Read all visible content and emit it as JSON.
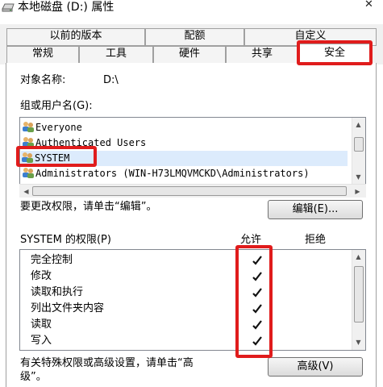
{
  "window": {
    "title": "本地磁盘 (D:) 属性",
    "close_glyph": "✕"
  },
  "tabs": {
    "row_back": [
      "以前的版本",
      "配额",
      "自定义"
    ],
    "row_front": [
      "常规",
      "工具",
      "硬件",
      "共享",
      "安全"
    ],
    "selected": "安全"
  },
  "object": {
    "label": "对象名称:",
    "value": "D:\\"
  },
  "groups": {
    "label": "组或用户名(G):",
    "items": [
      "Everyone",
      "Authenticated Users",
      "SYSTEM",
      "Administrators (WIN-H73LMQVMCKD\\Administrators)"
    ],
    "selected": "SYSTEM"
  },
  "edit": {
    "hint": "要更改权限，请单击“编辑”。",
    "button": "编辑(E)..."
  },
  "permissions": {
    "header": "SYSTEM 的权限(P)",
    "allow_header": "允许",
    "deny_header": "拒绝",
    "items": [
      {
        "name": "完全控制",
        "allow": true,
        "deny": false
      },
      {
        "name": "修改",
        "allow": true,
        "deny": false
      },
      {
        "name": "读取和执行",
        "allow": true,
        "deny": false
      },
      {
        "name": "列出文件夹内容",
        "allow": true,
        "deny": false
      },
      {
        "name": "读取",
        "allow": true,
        "deny": false
      },
      {
        "name": "写入",
        "allow": true,
        "deny": false
      }
    ]
  },
  "advanced": {
    "hint_line1": "有关特殊权限或高级设置，请单击“高",
    "hint_line2": "级”。",
    "button": "高级(V)"
  },
  "colors": {
    "highlight": "#e01c1c",
    "selection": "#dcebfc"
  }
}
